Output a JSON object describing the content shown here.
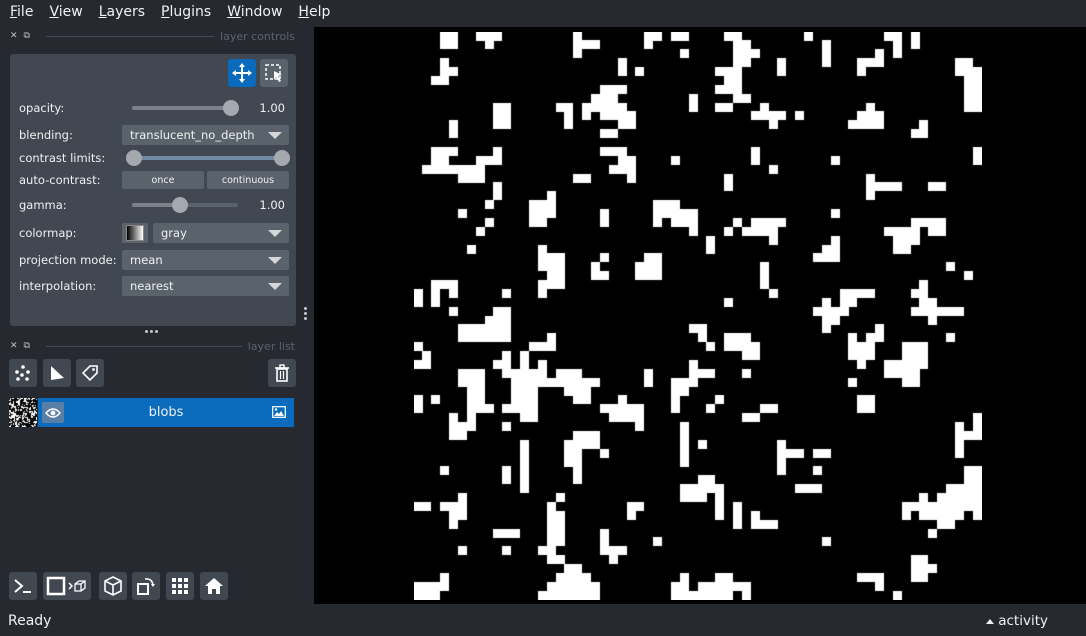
{
  "menu": [
    {
      "accel": "F",
      "rest": "ile"
    },
    {
      "accel": "V",
      "rest": "iew"
    },
    {
      "accel": "L",
      "rest": "ayers"
    },
    {
      "accel": "P",
      "rest": "lugins"
    },
    {
      "accel": "W",
      "rest": "indow"
    },
    {
      "accel": "H",
      "rest": "elp"
    }
  ],
  "layer_controls": {
    "title": "layer controls",
    "opacity": {
      "label": "opacity:",
      "value": "1.00",
      "level": 1.0
    },
    "blending": {
      "label": "blending:",
      "value": "translucent_no_depth"
    },
    "contrast_limits": {
      "label": "contrast limits:",
      "low": 0.0,
      "high": 1.0
    },
    "auto_contrast": {
      "label": "auto-contrast:",
      "once": "once",
      "continuous": "continuous"
    },
    "gamma": {
      "label": "gamma:",
      "value": "1.00",
      "level": 0.5
    },
    "colormap": {
      "label": "colormap:",
      "value": "gray"
    },
    "projection_mode": {
      "label": "projection mode:",
      "value": "mean"
    },
    "interpolation": {
      "label": "interpolation:",
      "value": "nearest"
    }
  },
  "layer_list": {
    "title": "layer list",
    "layers": [
      {
        "name": "blobs",
        "visible": true,
        "type": "image"
      }
    ]
  },
  "status": {
    "text": "Ready",
    "activity": "activity"
  },
  "colors": {
    "accent": "#0a6bbd",
    "panel": "#414851",
    "bg": "#262930"
  }
}
